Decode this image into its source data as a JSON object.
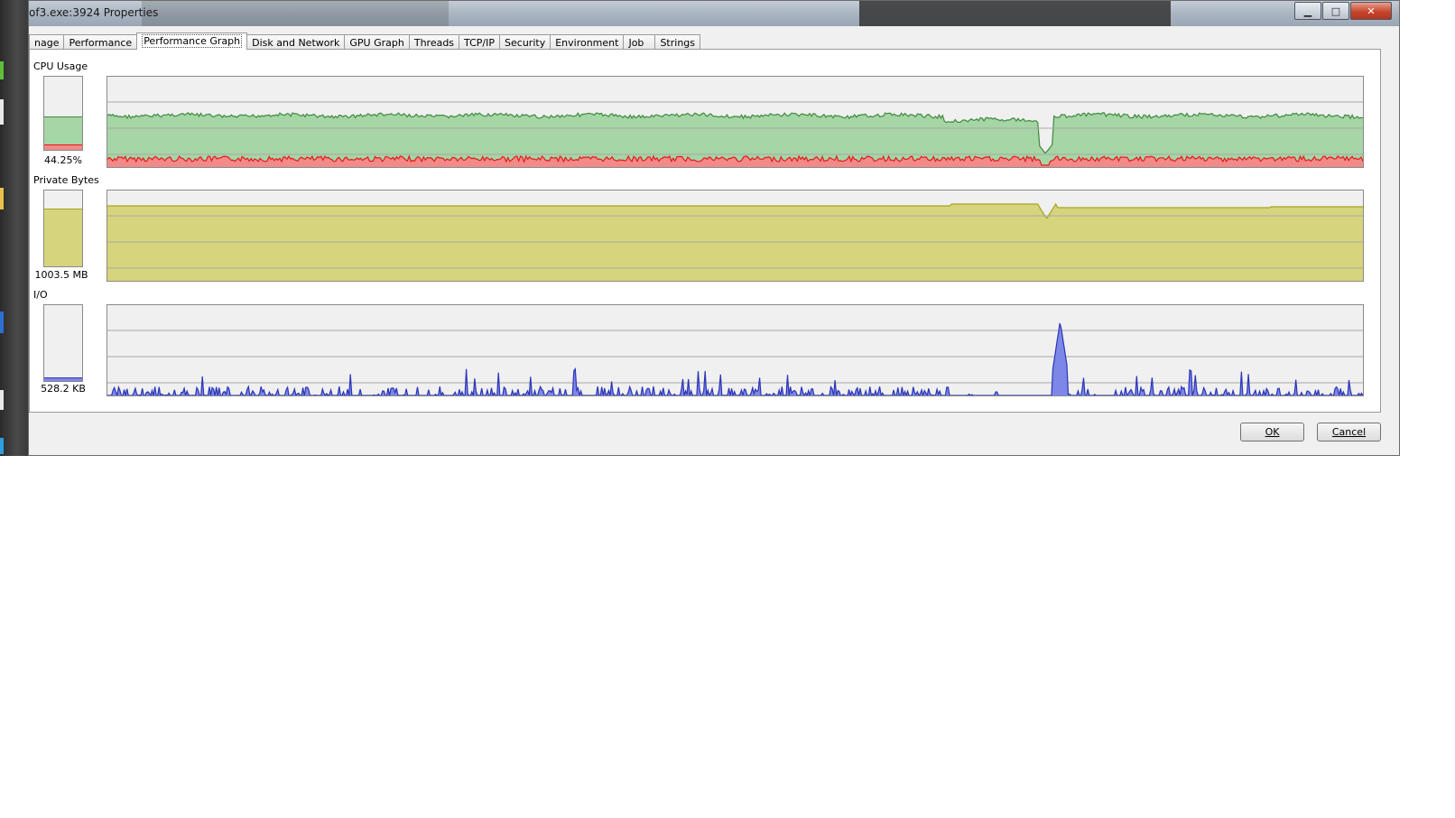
{
  "window": {
    "title": "of3.exe:3924 Properties",
    "min_glyph": "▁",
    "max_glyph": "□",
    "close_glyph": "✕"
  },
  "tabs": [
    {
      "label": "nage",
      "active": false
    },
    {
      "label": "Performance",
      "active": false
    },
    {
      "label": "Performance Graph",
      "active": true
    },
    {
      "label": "Disk and Network",
      "active": false
    },
    {
      "label": "GPU Graph",
      "active": false
    },
    {
      "label": "Threads",
      "active": false
    },
    {
      "label": "TCP/IP",
      "active": false
    },
    {
      "label": "Security",
      "active": false
    },
    {
      "label": "Environment",
      "active": false
    },
    {
      "label": "Job",
      "active": false
    },
    {
      "label": "Strings",
      "active": false
    }
  ],
  "cpu": {
    "label": "CPU Usage",
    "value_text": "44.25%",
    "total_fraction": 0.4425,
    "kernel_fraction": 0.06,
    "total_color": "#a6d5a6",
    "total_line": "#3d8a3d",
    "kernel_color": "#f28a8a",
    "kernel_line": "#e41a1a"
  },
  "private_bytes": {
    "label": "Private Bytes",
    "value_text": "1003.5 MB",
    "fraction": 0.75,
    "fill_color": "#d6d57d",
    "line_color": "#a8a41e"
  },
  "io": {
    "label": "I/O",
    "value_text": "528.2 KB",
    "fraction": 0.03,
    "fill_color": "#7d87e6",
    "line_color": "#2b35b8"
  },
  "buttons": {
    "ok": "OK",
    "cancel": "Cancel"
  }
}
